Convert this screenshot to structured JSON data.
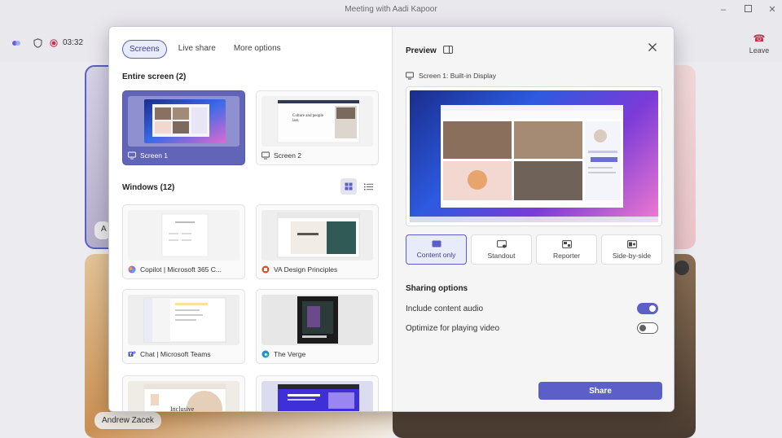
{
  "window": {
    "title": "Meeting with Aadi Kapoor",
    "controls": [
      "minimize-icon",
      "maximize-icon",
      "close-icon"
    ]
  },
  "meeting_bar": {
    "timer": "03:32",
    "leave_label": "Leave"
  },
  "participants": {
    "name_chip": "Andrew Zacek",
    "side_initial": "A"
  },
  "dialog": {
    "tabs": [
      {
        "label": "Screens",
        "active": true
      },
      {
        "label": "Live share",
        "active": false
      },
      {
        "label": "More options",
        "active": false
      }
    ],
    "entire_screen_heading": "Entire screen (2)",
    "screens": [
      {
        "label": "Screen 1",
        "icon": "monitor-icon",
        "selected": true
      },
      {
        "label": "Screen 2",
        "icon": "monitor-icon",
        "selected": false
      }
    ],
    "windows_heading": "Windows (12)",
    "windows": [
      {
        "label": "Copilot | Microsoft 365 C...",
        "icon": "copilot-icon"
      },
      {
        "label": "VA Design Principles",
        "icon": "powerpoint-icon"
      },
      {
        "label": "Chat | Microsoft Teams",
        "icon": "teams-icon"
      },
      {
        "label": "The Verge",
        "icon": "edge-icon"
      },
      {
        "label": "",
        "icon": ""
      },
      {
        "label": "",
        "icon": ""
      }
    ],
    "thumb_text": {
      "screen2_line": "Culture and people last.",
      "inclusive": "Inclusive"
    },
    "preview": {
      "heading": "Preview",
      "source": "Screen 1: Built-in Display",
      "layouts": [
        {
          "label": "Content only",
          "active": true
        },
        {
          "label": "Standout",
          "active": false
        },
        {
          "label": "Reporter",
          "active": false
        },
        {
          "label": "Side-by-side",
          "active": false
        }
      ]
    },
    "sharing_options": {
      "heading": "Sharing options",
      "options": [
        {
          "label": "Include content audio",
          "on": true
        },
        {
          "label": "Optimize for playing video",
          "on": false
        }
      ]
    },
    "share_label": "Share"
  },
  "colors": {
    "accent": "#5b5fc7",
    "selected_card": "#6264b8"
  }
}
